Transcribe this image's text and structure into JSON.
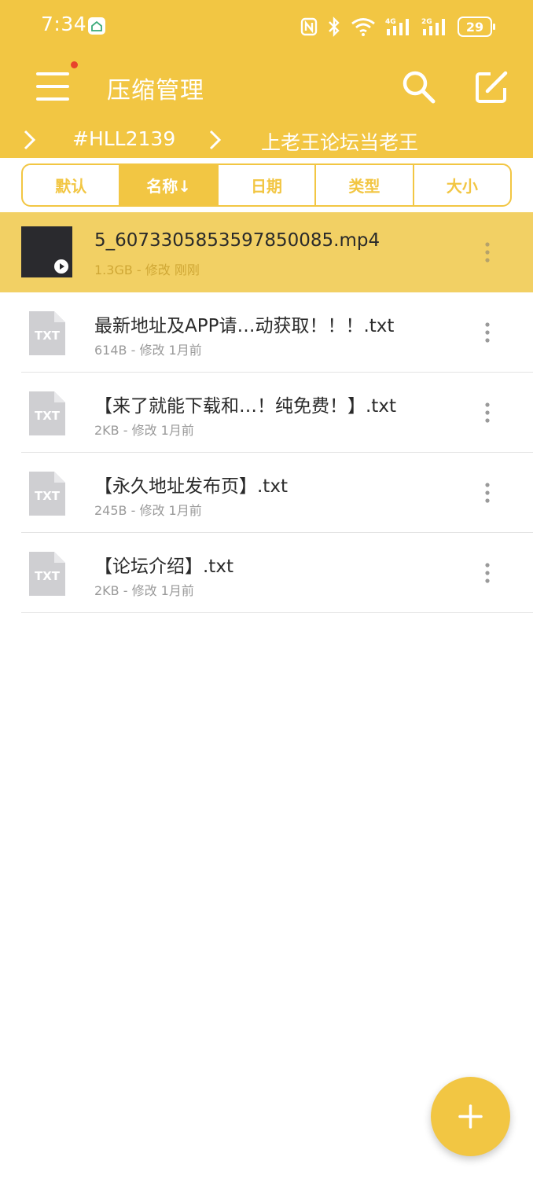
{
  "status_bar": {
    "time": "7:34",
    "battery": "29"
  },
  "toolbar": {
    "title": "压缩管理",
    "colors": {
      "accent": "#F2C643",
      "notification_dot": "#E8432C"
    }
  },
  "breadcrumb": {
    "items": [
      "#HLL2139",
      "上老王论坛当老王"
    ]
  },
  "sort_tabs": [
    {
      "label": "默认",
      "active": false
    },
    {
      "label": "名称↓",
      "active": true
    },
    {
      "label": "日期",
      "active": false
    },
    {
      "label": "类型",
      "active": false
    },
    {
      "label": "大小",
      "active": false
    }
  ],
  "files": [
    {
      "name": "5_6073305853597850085.mp4",
      "meta": "1.3GB - 修改 刚刚",
      "type": "video",
      "selected": true
    },
    {
      "name": "最新地址及APP请…动获取！！！.txt",
      "meta": "614B - 修改 1月前",
      "type": "txt",
      "selected": false
    },
    {
      "name": "【来了就能下载和…！纯免费！】.txt",
      "meta": "2KB - 修改 1月前",
      "type": "txt",
      "selected": false
    },
    {
      "name": "【永久地址发布页】.txt",
      "meta": "245B - 修改 1月前",
      "type": "txt",
      "selected": false
    },
    {
      "name": "【论坛介绍】.txt",
      "meta": "2KB - 修改 1月前",
      "type": "txt",
      "selected": false
    }
  ],
  "txt_icon_label": "TXT"
}
